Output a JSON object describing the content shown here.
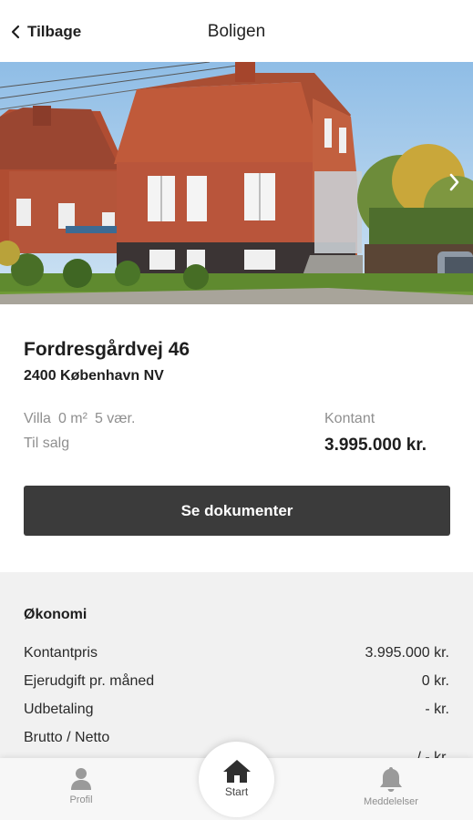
{
  "header": {
    "back_label": "Tilbage",
    "title": "Boligen"
  },
  "listing": {
    "address": "Fordresgårdvej 46",
    "city": "2400 København NV",
    "type": "Villa",
    "area": "0 m²",
    "rooms": "5 vær.",
    "status": "Til salg",
    "price_label": "Kontant",
    "price": "3.995.000 kr.",
    "documents_button": "Se dokumenter"
  },
  "economy": {
    "title": "Økonomi",
    "rows": [
      {
        "label": "Kontantpris",
        "value": "3.995.000 kr."
      },
      {
        "label": "Ejerudgift pr. måned",
        "value": "0 kr."
      },
      {
        "label": "Udbetaling",
        "value": "- kr."
      },
      {
        "label": "Brutto / Netto",
        "value": "/ - kr."
      }
    ]
  },
  "tabbar": {
    "profile": "Profil",
    "start": "Start",
    "messages": "Meddelelser"
  },
  "icons": {
    "back": "chevron-left-icon",
    "next": "chevron-right-icon",
    "profile": "person-icon",
    "start": "home-icon",
    "messages": "bell-icon"
  },
  "colors": {
    "button_bg": "#3b3b3b",
    "section_bg": "#f1f1f1",
    "muted_text": "#8f8f8f"
  }
}
